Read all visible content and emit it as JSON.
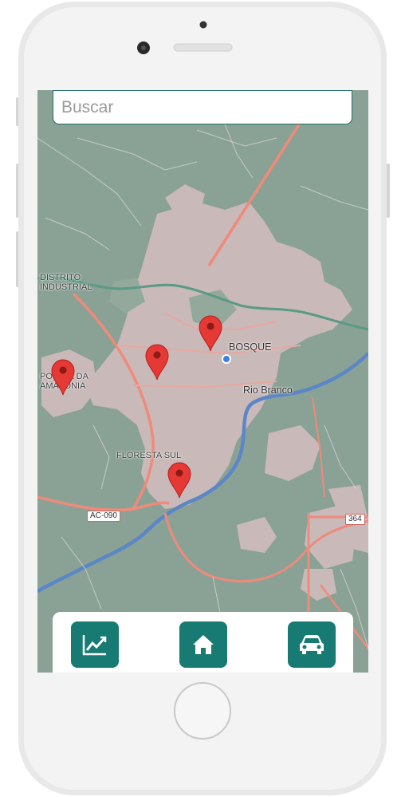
{
  "search": {
    "placeholder": "Buscar"
  },
  "map": {
    "labels": {
      "distrito_line1": "DISTRITO",
      "distrito_line2": "INDUSTRIAL",
      "bosque": "BOSQUE",
      "rio_branco": "Rio Branco",
      "floresta_sul": "FLORESTA SUL",
      "porta_line1": "PORTAL DA",
      "porta_line2": "AMAZÔNIA"
    },
    "road_shields": {
      "ac090": "AC-090",
      "r364": "364"
    },
    "colors": {
      "land": "#8aa295",
      "urban": "#c9b9b9",
      "road": "#f08a7a",
      "river": "#5b86c7",
      "pin": "#e53935"
    }
  },
  "toolbar": {
    "stats_icon": "chart-line-icon",
    "home_icon": "home-icon",
    "car_icon": "car-icon",
    "accent": "#177a73"
  }
}
